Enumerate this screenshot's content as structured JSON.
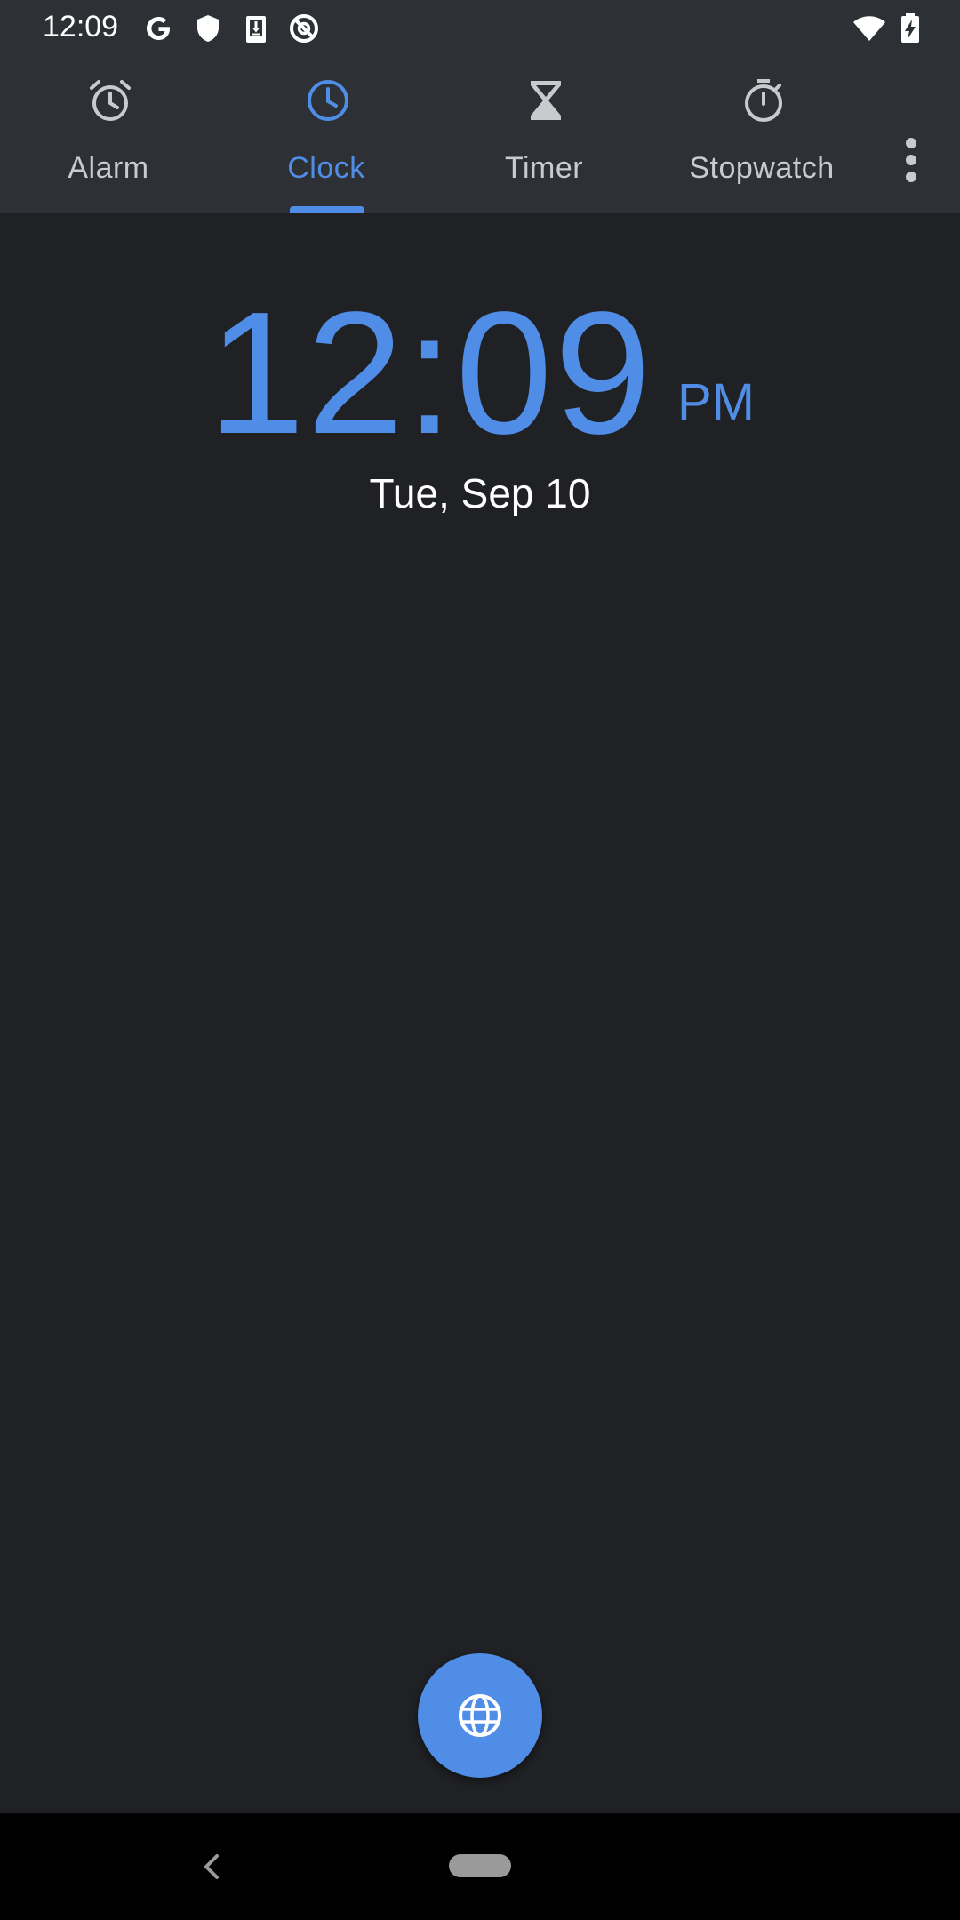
{
  "status_bar": {
    "time": "12:09",
    "icons": [
      "google-g-icon",
      "shield-icon",
      "download-icon",
      "no-data-icon",
      "wifi-icon",
      "battery-charging-icon"
    ]
  },
  "tabs": [
    {
      "label": "Alarm",
      "icon": "alarm-clock-icon",
      "active": false
    },
    {
      "label": "Clock",
      "icon": "clock-icon",
      "active": true
    },
    {
      "label": "Timer",
      "icon": "hourglass-icon",
      "active": false
    },
    {
      "label": "Stopwatch",
      "icon": "stopwatch-icon",
      "active": false
    }
  ],
  "menu": {
    "icon": "more-vert-icon"
  },
  "clock": {
    "time": "12:09",
    "ampm": "PM",
    "date": "Tue, Sep 10"
  },
  "fab": {
    "icon": "globe-icon"
  },
  "nav": {
    "back_icon": "back-chevron-icon",
    "home_icon": "home-pill-icon"
  },
  "colors": {
    "accent": "#4f8de6",
    "background": "#202124",
    "toolbar": "#2d3034",
    "inactive_text": "#c8cacd"
  }
}
